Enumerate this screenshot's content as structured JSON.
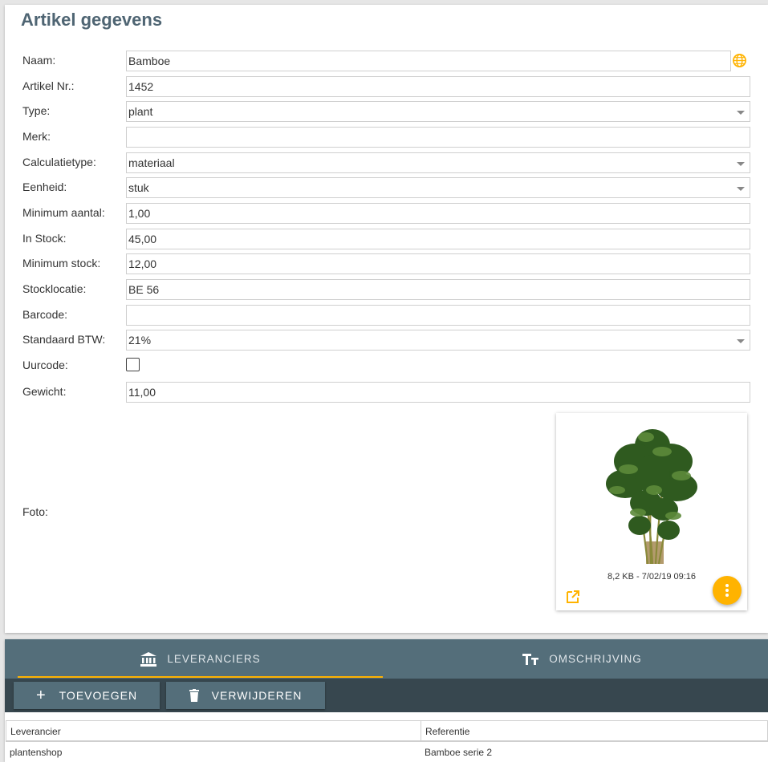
{
  "page": {
    "title": "Artikel gegevens"
  },
  "form": {
    "naam": {
      "label": "Naam:",
      "value": "Bamboe"
    },
    "artikel_nr": {
      "label": "Artikel Nr.:",
      "value": "1452"
    },
    "type": {
      "label": "Type:",
      "value": "plant"
    },
    "merk": {
      "label": "Merk:",
      "value": ""
    },
    "calculatietype": {
      "label": "Calculatietype:",
      "value": "materiaal"
    },
    "eenheid": {
      "label": "Eenheid:",
      "value": "stuk"
    },
    "minimum_aantal": {
      "label": "Minimum aantal:",
      "value": "1,00"
    },
    "in_stock": {
      "label": "In Stock:",
      "value": "45,00"
    },
    "minimum_stock": {
      "label": "Minimum stock:",
      "value": "12,00"
    },
    "stocklocatie": {
      "label": "Stocklocatie:",
      "value": "BE 56"
    },
    "barcode": {
      "label": "Barcode:",
      "value": ""
    },
    "standaard_btw": {
      "label": "Standaard BTW:",
      "value": "21%"
    },
    "uurcode": {
      "label": "Uurcode:",
      "checked": false
    },
    "gewicht": {
      "label": "Gewicht:",
      "value": "11,00"
    },
    "foto": {
      "label": "Foto:",
      "caption": "8,2 KB - 7/02/19 09:16"
    }
  },
  "icons": {
    "globe": "globe-icon",
    "open": "open-external-icon",
    "more": "more-vert-icon",
    "bank": "bank-icon",
    "text": "text-size-icon",
    "plus": "plus-icon",
    "trash": "trash-icon"
  },
  "tabs": [
    {
      "label": "LEVERANCIERS",
      "active": true
    },
    {
      "label": "OMSCHRIJVING",
      "active": false
    }
  ],
  "toolbar": {
    "add_label": "TOEVOEGEN",
    "delete_label": "VERWIJDEREN"
  },
  "table": {
    "columns": [
      "Leverancier",
      "Referentie"
    ],
    "rows": [
      [
        "plantenshop",
        "Bamboe serie 2"
      ]
    ]
  },
  "colors": {
    "title": "#4f6573",
    "accent": "#ffb300",
    "tabbar": "#546e7a",
    "toolbar": "#37474f"
  }
}
